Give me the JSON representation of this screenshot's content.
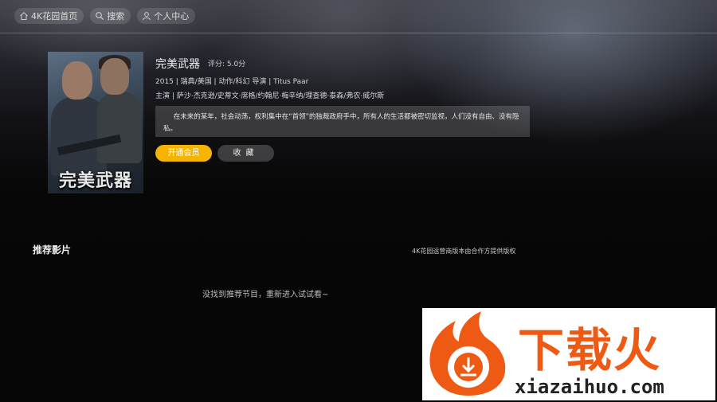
{
  "nav": {
    "items": [
      {
        "label": "4K花园首页",
        "icon": "home-icon"
      },
      {
        "label": "搜索",
        "icon": "search-icon"
      },
      {
        "label": "个人中心",
        "icon": "user-icon"
      }
    ]
  },
  "poster": {
    "title_text": "完美武器"
  },
  "movie": {
    "title": "完美武器",
    "rating": "评分: 5.0分",
    "meta": "2015 | 瑞典/美国 | 动作/科幻    导演 | Titus Paar",
    "cast": "主演 | 萨沙·杰克逊/史蒂文·席格/约翰尼·梅辛纳/理查德·泰森/弗农·威尔斯",
    "synopsis": "在未来的某年，社会动荡，权利集中在“首领”的独裁政府手中，所有人的生活都被密切监视，人们没有自由、没有隐私。"
  },
  "buttons": {
    "member": "开通会员",
    "favorite": "收藏"
  },
  "recommend": {
    "heading": "推荐影片",
    "copyright": "4K花园运营商版本由合作方提供版权",
    "empty": "没找到推荐节目，重新进入试试看~"
  },
  "watermark": {
    "cn": "下载火",
    "url": "xiazaihuo.com"
  },
  "colors": {
    "accent": "#f4b400",
    "watermark_orange": "#ee5a13"
  }
}
